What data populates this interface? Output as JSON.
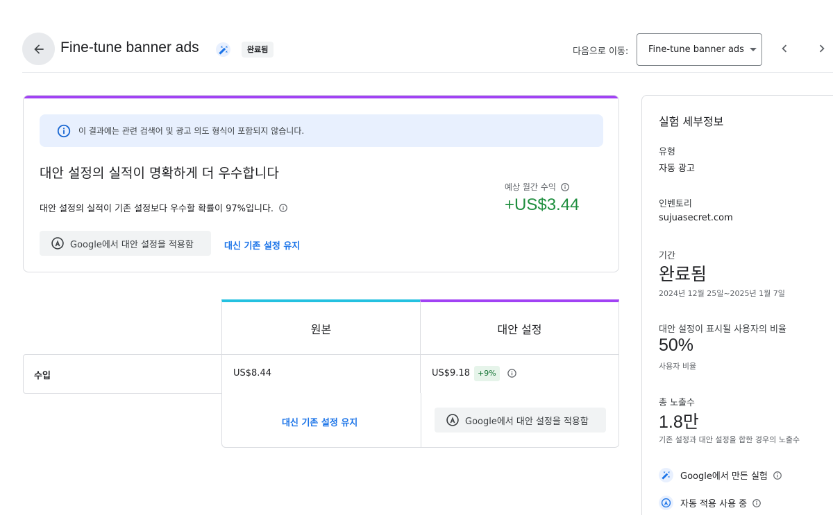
{
  "header": {
    "title": "Fine-tune banner ads",
    "status_chip": "완료됨",
    "goto_label": "다음으로 이동:",
    "goto_selected": "Fine-tune banner ads"
  },
  "result_card": {
    "info_text": "이 결과에는 관련 검색어 및 광고 의도 형식이 포함되지 않습니다.",
    "headline": "대안 설정의 실적이 명확하게 더 우수합니다",
    "description": "대안 설정의 실적이 기존 설정보다 우수할 확률이 97%입니다.",
    "apply_button": "Google에서 대안 설정을 적용함",
    "keep_link": "대신 기존 설정 유지",
    "revenue_label": "예상 월간 수익",
    "revenue_value": "+US$3.44"
  },
  "table": {
    "col_original": "원본",
    "col_alternative": "대안 설정",
    "rows": [
      {
        "label": "수입",
        "original": "US$8.44",
        "alternative": "US$9.18",
        "delta": "+9%"
      }
    ],
    "keep_link": "대신 기존 설정 유지",
    "apply_button": "Google에서 대안 설정을 적용함"
  },
  "side_panel": {
    "title": "실험 세부정보",
    "type_label": "유형",
    "type_value": "자동 광고",
    "inventory_label": "인벤토리",
    "inventory_value": "sujuasecret.com",
    "period_label": "기간",
    "period_value": "완료됨",
    "period_dates": "2024년 12월 25일~2025년 1월 7일",
    "share_label": "대안 설정이 표시될 사용자의 비율",
    "share_value": "50%",
    "share_sub": "사용자 비율",
    "impressions_label": "총 노출수",
    "impressions_value": "1.8만",
    "impressions_sub": "기존 설정과 대안 설정을 합한 경우의 노출수",
    "flag_google": "Google에서 만든 실험",
    "flag_auto": "자동 적용 사용 중"
  },
  "colors": {
    "accent_purple": "#a142f4",
    "accent_cyan": "#24c1e0",
    "positive_green": "#1e8e3e",
    "link_blue": "#1a73e8"
  },
  "icons": [
    "back-arrow-icon",
    "magic-wand-icon",
    "chevron-left-icon",
    "chevron-right-icon",
    "info-icon",
    "auto-apply-icon"
  ]
}
